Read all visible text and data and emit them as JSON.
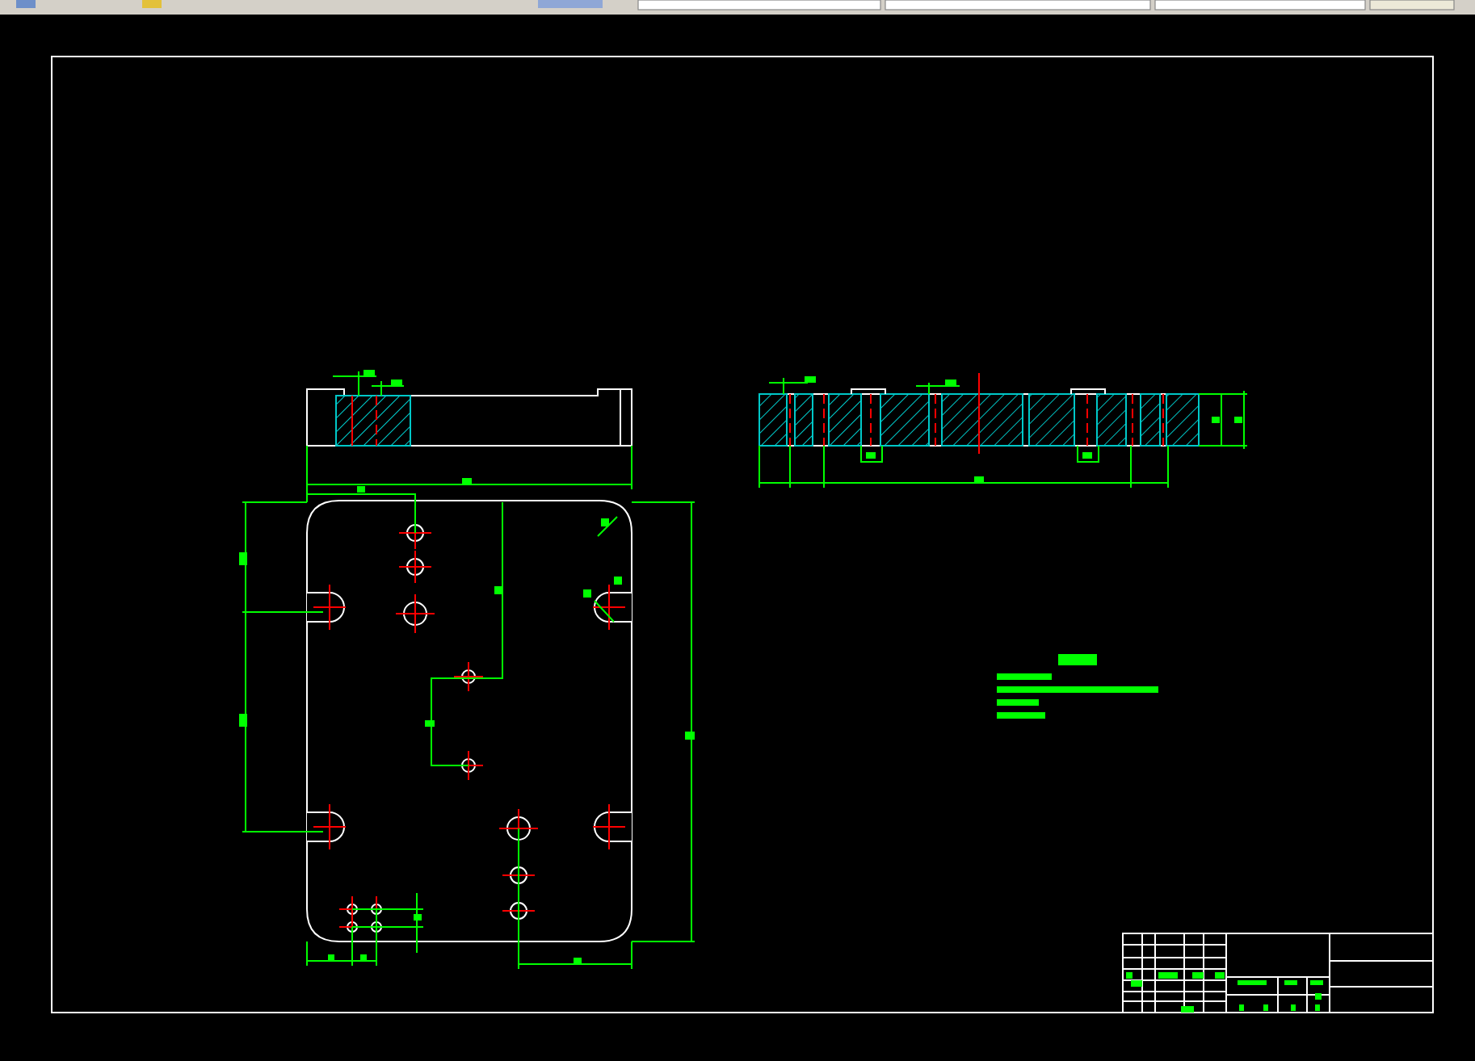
{
  "canvas": {
    "kind": "cad-drawing"
  }
}
